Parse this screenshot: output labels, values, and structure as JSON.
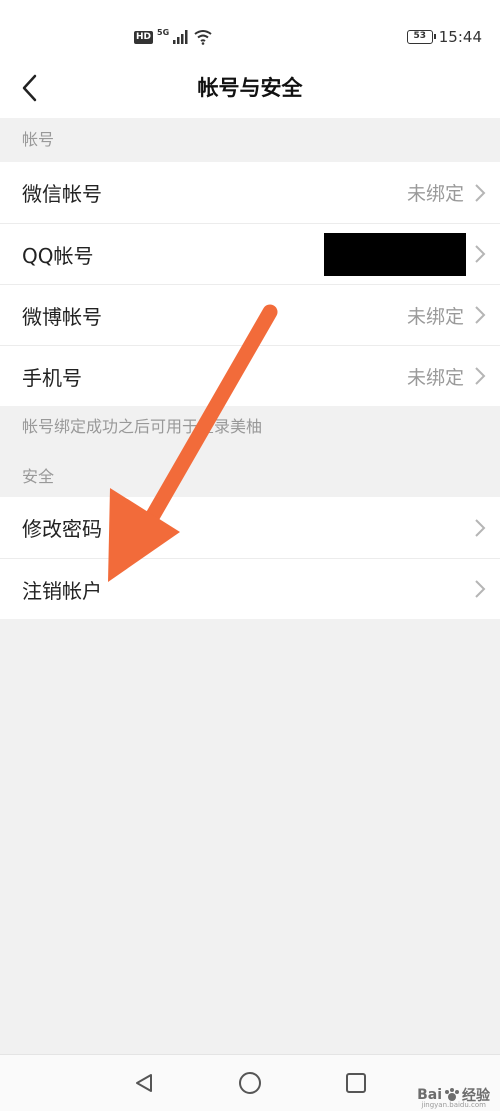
{
  "status_bar": {
    "hd_badge": "HD",
    "network": "5G",
    "battery": "53",
    "time": "15:44"
  },
  "header": {
    "title": "帐号与安全",
    "back_icon": "chevron-left-icon"
  },
  "sections": {
    "account": {
      "header": "帐号",
      "items": [
        {
          "label": "微信帐号",
          "value": "未绑定"
        },
        {
          "label": "QQ帐号",
          "value": ""
        },
        {
          "label": "微博帐号",
          "value": "未绑定"
        },
        {
          "label": "手机号",
          "value": "未绑定"
        }
      ],
      "note": "帐号绑定成功之后可用于登录美柚"
    },
    "security": {
      "header": "安全",
      "items": [
        {
          "label": "修改密码"
        },
        {
          "label": "注销帐户"
        }
      ]
    }
  },
  "annotation": {
    "arrow_color": "#f26b3a",
    "arrow_icon": "pointing-arrow"
  },
  "bottom_nav": {
    "back_icon": "triangle-back-icon",
    "home_icon": "circle-home-icon",
    "recents_icon": "square-recents-icon"
  },
  "watermark": {
    "brand": "Bai",
    "brand_suffix": "经验",
    "url": "jingyan.baidu.com"
  },
  "colors": {
    "background": "#f1f1f1",
    "card": "#ffffff",
    "muted_text": "#999999"
  }
}
